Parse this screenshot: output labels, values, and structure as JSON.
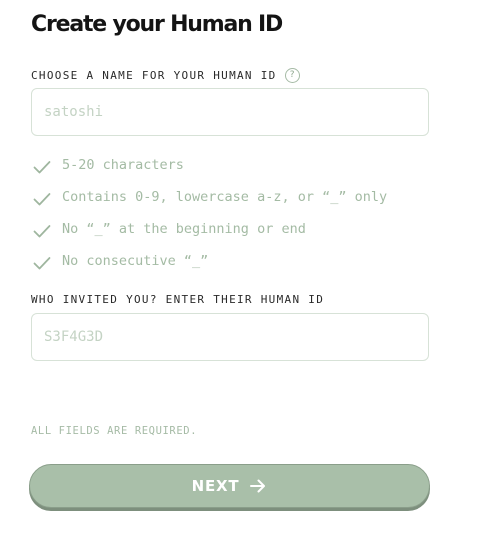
{
  "page": {
    "title": "Create your Human ID"
  },
  "name_field": {
    "label": "CHOOSE A NAME FOR YOUR HUMAN ID",
    "help_icon_glyph": "?",
    "placeholder": "satoshi",
    "value": ""
  },
  "rules": [
    {
      "text": "5-20 characters",
      "icon": "check-icon"
    },
    {
      "text": "Contains 0-9, lowercase a-z, or “_” only",
      "icon": "check-icon"
    },
    {
      "text": "No “_” at the beginning or end",
      "icon": "check-icon"
    },
    {
      "text": "No consecutive “_”",
      "icon": "check-icon"
    }
  ],
  "invite_field": {
    "label": "WHO INVITED YOU? ENTER THEIR HUMAN ID",
    "placeholder": "S3F4G3D",
    "value": ""
  },
  "required_note": "ALL FIELDS ARE REQUIRED.",
  "next_button": {
    "label": "NEXT",
    "icon": "arrow-right-icon"
  },
  "colors": {
    "accent": "#a9bfa9",
    "rule_text": "#a4bba4",
    "placeholder": "#c4d3c4",
    "input_border": "#d7e2d7"
  }
}
